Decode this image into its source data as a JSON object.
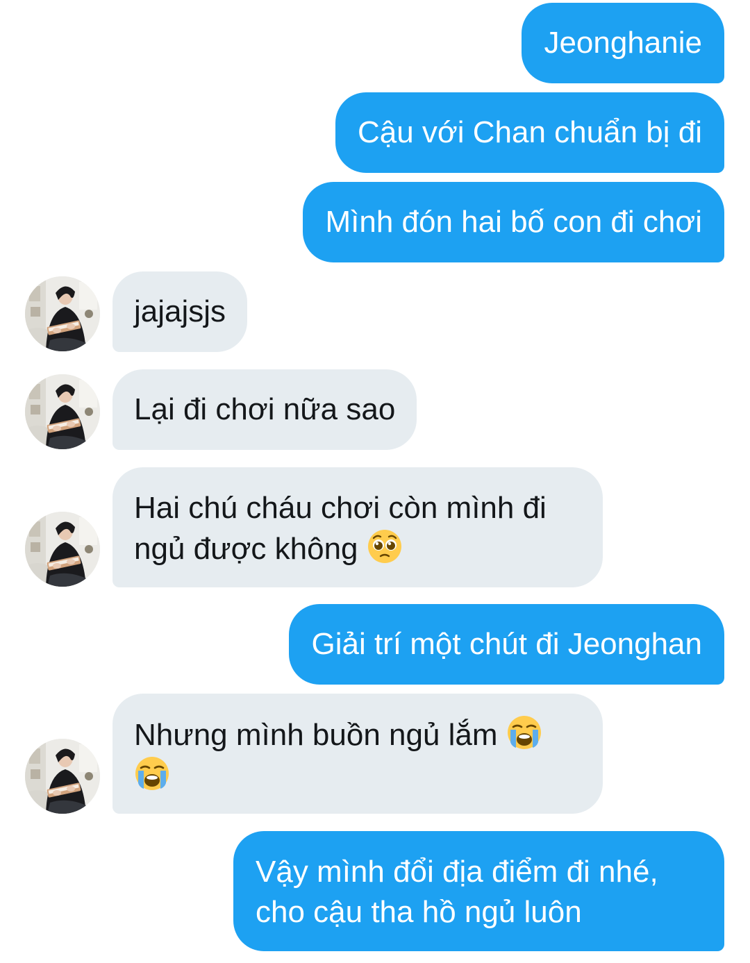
{
  "contact": {
    "avatar": "profile-photo"
  },
  "messages": [
    {
      "id": "m1",
      "direction": "sent",
      "text": "Jeonghanie"
    },
    {
      "id": "m2",
      "direction": "sent",
      "text": "Cậu với Chan chuẩn bị đi"
    },
    {
      "id": "m3",
      "direction": "sent",
      "text": "Mình đón hai bố con đi chơi"
    },
    {
      "id": "m4",
      "direction": "received",
      "text": "jajajsjs"
    },
    {
      "id": "m5",
      "direction": "received",
      "text": "Lại đi chơi nữa sao"
    },
    {
      "id": "m6",
      "direction": "received",
      "lines": [
        "Hai chú cháu chơi còn mình đi",
        "ngủ được không"
      ],
      "emoji": [
        "pleading-face-emoji"
      ]
    },
    {
      "id": "m7",
      "direction": "sent",
      "text": "Giải trí một chút đi Jeonghan"
    },
    {
      "id": "m8",
      "direction": "received",
      "lines": [
        "Nhưng mình buồn ngủ lắm"
      ],
      "emoji": [
        "loudly-crying-face-emoji",
        "loudly-crying-face-emoji"
      ]
    },
    {
      "id": "m9",
      "direction": "sent",
      "lines": [
        "Vậy mình đổi địa điểm đi nhé,",
        "cho cậu tha hồ ngủ luôn"
      ]
    }
  ],
  "colors": {
    "sent_bubble": "#1da1f2",
    "received_bubble": "#e6ecf0",
    "sent_text": "#ffffff",
    "received_text": "#14171a"
  }
}
